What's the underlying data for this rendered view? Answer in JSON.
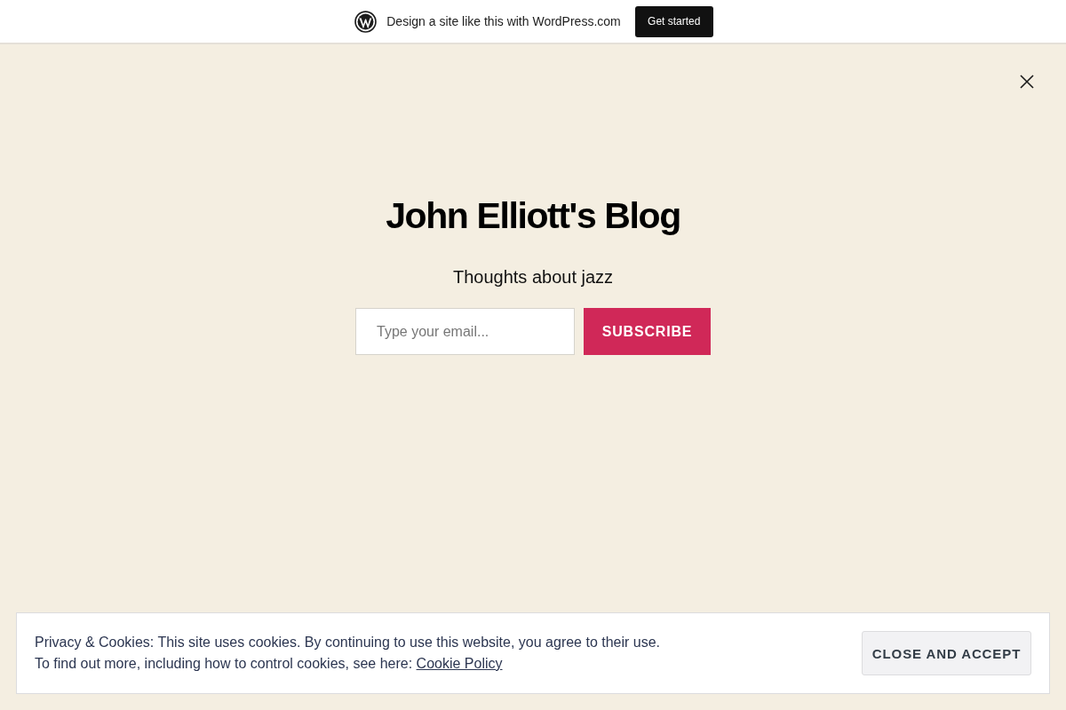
{
  "top_bar": {
    "promo_text": "Design a site like this with WordPress.com",
    "button": "Get started"
  },
  "header": {
    "title": "John Elliott's Blog",
    "tagline": "Thoughts about jazz"
  },
  "subscribe_form": {
    "placeholder": "Type your email...",
    "button": "SUBSCRIBE"
  },
  "cookie_notice": {
    "line_1": "Privacy & Cookies: This site uses cookies. By continuing to use this website, you agree to their use.",
    "line_2": "To find out more, including how to control cookies, see here:",
    "link": "Cookie Policy",
    "button": "CLOSE AND ACCEPT"
  }
}
